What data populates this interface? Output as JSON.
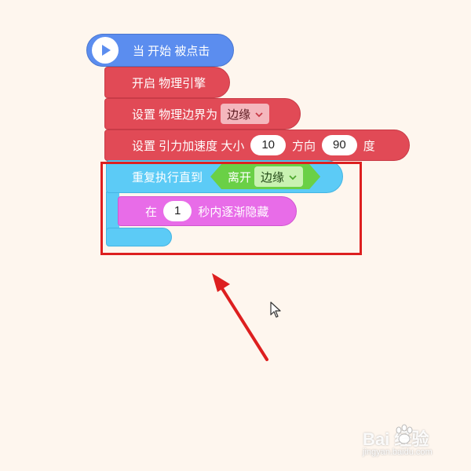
{
  "blocks": {
    "hat": {
      "label": "当 开始 被点击"
    },
    "enable_physics": {
      "label": "开启 物理引擎"
    },
    "set_boundary": {
      "label": "设置 物理边界为",
      "dropdown_value": "边缘"
    },
    "set_gravity": {
      "label_prefix": "设置 引力加速度 大小",
      "size_value": "10",
      "direction_label": "方向",
      "direction_value": "90",
      "suffix": "度"
    },
    "repeat_until": {
      "label": "重复执行直到",
      "condition_label": "离开",
      "condition_dropdown": "边缘"
    },
    "fade_out": {
      "prefix": "在",
      "seconds_value": "1",
      "suffix": "秒内逐渐隐藏"
    }
  },
  "colors": {
    "background": "#fef6ee",
    "event_blue": "#5b8def",
    "physics_red": "#e14a56",
    "control_cyan": "#5ccbf6",
    "looks_magenta": "#e86ce8",
    "sensing_green": "#6ad046",
    "highlight_red": "#dd1f1f"
  },
  "watermark": {
    "logo_text": "Bai 经验",
    "url": "jingyan.baidu.com"
  }
}
